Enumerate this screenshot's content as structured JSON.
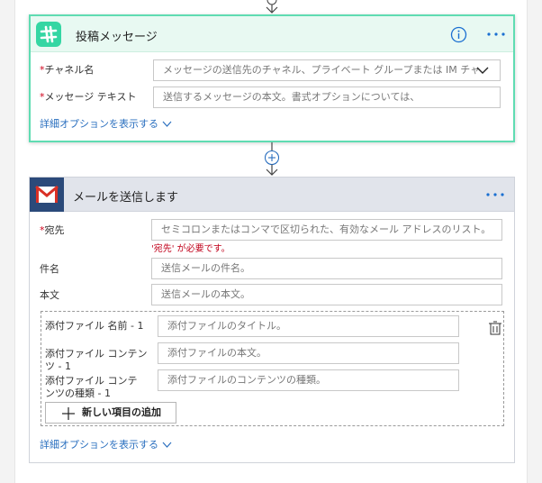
{
  "slack_card": {
    "title": "投稿メッセージ",
    "channel": {
      "required": "*",
      "label": "チャネル名",
      "placeholder": "メッセージの送信先のチャネル、プライベート グループまたは IM チャ"
    },
    "message": {
      "required": "*",
      "label": "メッセージ テキスト",
      "placeholder": "送信するメッセージの本文。書式オプションについては、"
    },
    "advanced_link": "詳細オプションを表示する"
  },
  "gmail_card": {
    "title": "メールを送信します",
    "to": {
      "required": "*",
      "label": "宛先",
      "placeholder": "セミコロンまたはコンマで区切られた、有効なメール アドレスのリスト。",
      "error": "'宛先' が必要です。"
    },
    "subject": {
      "label": "件名",
      "placeholder": "送信メールの件名。"
    },
    "body": {
      "label": "本文",
      "placeholder": "送信メールの本文。"
    },
    "attachments": {
      "name": {
        "label": "添付ファイル 名前 - 1",
        "placeholder": "添付ファイルのタイトル。"
      },
      "content": {
        "label_line1": "添付ファイル コンテン",
        "label_line2": "ツ - 1",
        "placeholder": "添付ファイルの本文。"
      },
      "content_type": {
        "label_line1": "添付ファイル コンテ",
        "label_line2": "ンツの種類 - 1",
        "placeholder": "添付ファイルのコンテンツの種類。"
      },
      "add_button": "新しい項目の追加"
    },
    "advanced_link": "詳細オプションを表示する"
  },
  "colors": {
    "slack_border": "#5fdcb2",
    "slack_header": "#e8f9f2",
    "gmail_header": "#e1e4eb",
    "link": "#2a6fbf",
    "error": "#c0001a"
  },
  "icons": [
    "slack-icon",
    "info-icon",
    "more-icon",
    "chevron-down-icon",
    "gmail-icon",
    "add-step-icon",
    "arrow-down-icon",
    "delete-icon",
    "plus-icon"
  ]
}
